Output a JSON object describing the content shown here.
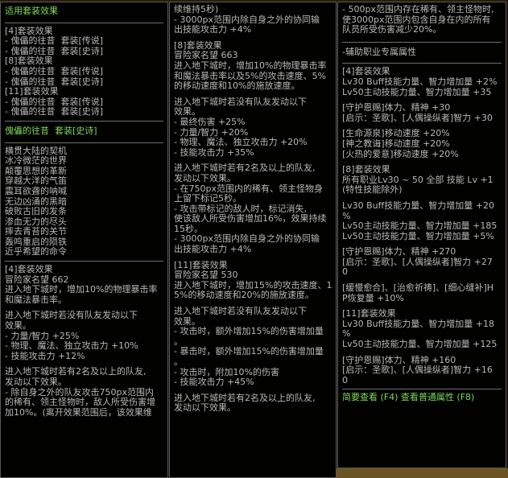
{
  "colors": {
    "panel_bg": "#000000",
    "text": "#b9b9b9",
    "highlight": "#7ed957",
    "border": "#5a5a5a"
  },
  "col1": {
    "header": "适用套装效果",
    "lines_a": [
      "[4]套装效果",
      "- 傀儡的往昔  套装[传说]",
      "- 傀儡的往昔  套装[史诗]",
      "[8]套装效果",
      "- 傀儡的往昔  套装[传说]",
      "- 傀儡的往昔  套装[史诗]",
      "[11]套装效果",
      "- 傀儡的往昔  套装[传说]",
      "- 傀儡的往昔  套装[史诗]"
    ],
    "set_title": "傀儡的往昔  套装[史诗]",
    "items": [
      "横贯大陆的契机",
      "冰冷微茫的世界",
      "颠覆思想的革新",
      "穿越大洋的气笛",
      "震耳欲聋的呐喊",
      "无边凶涌的黑暗",
      "破败古旧的发条",
      "渗血无力的尽头",
      "摔去青苔的关节",
      "轰鸣重启的陨铁",
      "近乎希望的命令"
    ],
    "lines_b": [
      "[4]套装效果",
      "冒险家名望 662",
      "进入地下城时，增加10%的物理暴击率",
      "和魔法暴击率。",
      "",
      "进入地下城时若没有队友发动以下",
      "效果。",
      "- 力量/智力 +25%",
      "- 物理、魔法、独立攻击力 +10%",
      "- 技能攻击力 +12%",
      "",
      "进入地下城时若有2名及以上的队友,",
      "发动以下效果。",
      "- 除自身之外的队友攻击750px范围内",
      "的稀有、领主怪物时，敌人所受伤害增",
      "加10%。(离开效果范围后，该效果维"
    ]
  },
  "col2": {
    "lines": [
      "续维持5秒)",
      "- 3000px范围内除自身之外的协同输",
      "出技能攻击力 +4%",
      "",
      "[8]套装效果",
      "冒险家名望 663",
      "进入地下城时，增加10%的物理暴击率",
      "和魔法暴击率以及5%的攻击速度、5%",
      "的移动速度和10%的施放速度。",
      "",
      "进入地下城时若没有队友发动以下",
      "效果。",
      "- 最终伤害 +25%",
      "- 力量/智力 +20%",
      "- 物理、魔法、独立攻击力 +20%",
      "- 技能攻击力 +35%",
      "",
      "进入地下城时若有2名及以上的队友,",
      "发动以下效果。",
      "- 在750px范围内的稀有、领主怪物身",
      "上留下标记5秒。",
      "- 攻击带标记的敌人时，标记消失,",
      "使该敌人所受伤害增加16%，效果持续",
      "15秒。",
      "- 3000px范围内除自身之外的协同输",
      "出技能攻击力 +4%",
      "",
      "[11]套装效果",
      "冒险家名望 530",
      "进入地下城时，增加15%的攻击速度、1",
      "5%的移动速度和20%的施放速度。",
      "",
      "进入地下城时若没有队友发动以下",
      "效果。",
      "- 攻击时，额外增加15%的伤害增加量",
      "。",
      "- 暴击时，额外增加15%的伤害增加量",
      "。",
      "- 攻击时，附加10%的伤害",
      "- 技能攻击力 +45%",
      "",
      "进入地下城时若有2名及以上的队友,",
      "发动以下效果。"
    ]
  },
  "col3": {
    "lines_a": [
      "- 500px范围内存在稀有、领主怪物时,",
      "使3000px范围内包含自身在内的所有",
      "队员所受伤害减少20%。"
    ],
    "support_title": "-辅助职业专属属性",
    "lines_b": [
      "[4]套装效果",
      "Lv30 Buff技能力量、智力增加量 +2%",
      "Lv50主动技能力量、智力增加量 +35",
      "",
      "[守护恩赐]体力、精神 +30",
      "[启示：圣歌]、[人偶操纵者]智力 +30",
      "",
      "[生命源泉]移动速度 +20%",
      "[神之教诲]移动速度 +20%",
      "[火热的爱意]移动速度 +20%",
      "",
      "[8]套装效果",
      "所有职业Lv30 ~ 50 全部 技能 Lv +1",
      "(特性技能除外)",
      "",
      "Lv30 Buff技能力量、智力增加量 +20",
      "%",
      "Lv50主动技能力量、智力增加量 +185",
      "Lv50主动技能力量、智力增加量 +5%",
      "",
      "[守护恩赐]体力、精神 +270",
      "[启示：圣歌]、[人偶操纵者]智力 +27",
      "0",
      "",
      "[缓慢愈合]、[治愈祈祷]、[细心缝补]H",
      "P恢复量 +10%",
      "",
      "[11]套装效果",
      "Lv30 Buff技能力量、智力增加量 +18",
      "%",
      "Lv50主动技能力量、智力增加量 +125",
      "",
      "[守护恩赐]体力、精神 +160",
      "[启示：圣歌]、[人偶操纵者]智力 +16",
      "0"
    ],
    "footer": "简要查看 (F4) 查看普通属性 (F8)"
  }
}
